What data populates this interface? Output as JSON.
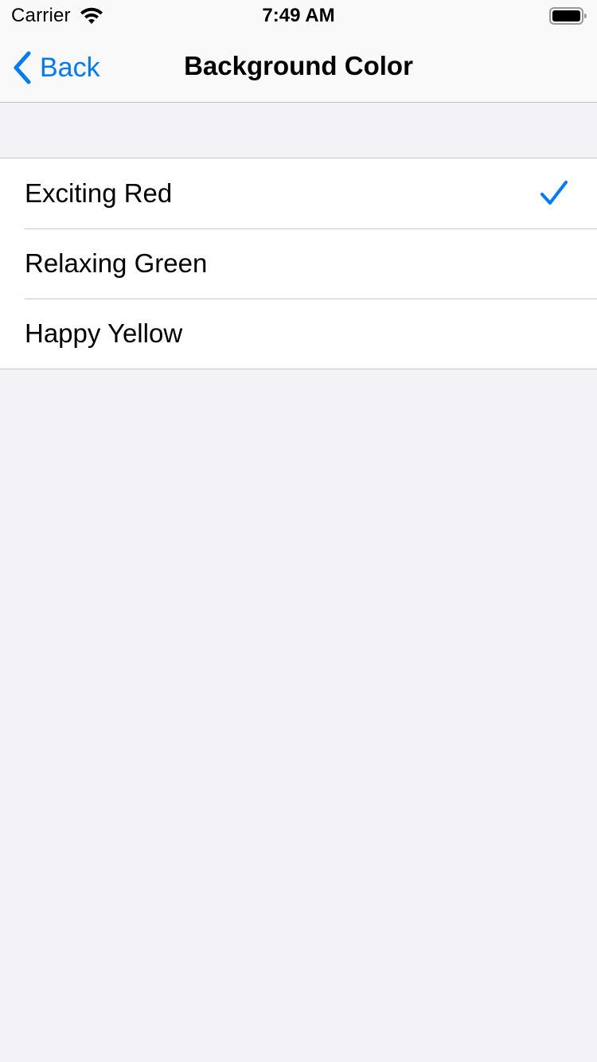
{
  "status_bar": {
    "carrier": "Carrier",
    "time": "7:49 AM",
    "wifi_icon": "wifi-icon",
    "battery_icon": "battery-icon"
  },
  "nav": {
    "back_label": "Back",
    "back_icon": "chevron-left-icon",
    "title": "Background Color"
  },
  "options": [
    {
      "label": "Exciting Red",
      "selected": true
    },
    {
      "label": "Relaxing Green",
      "selected": false
    },
    {
      "label": "Happy Yellow",
      "selected": false
    }
  ],
  "colors": {
    "accent": "#007aff",
    "background": "#f2f2f7",
    "bar": "#f9f9f9",
    "separator": "#c8c7cc"
  }
}
